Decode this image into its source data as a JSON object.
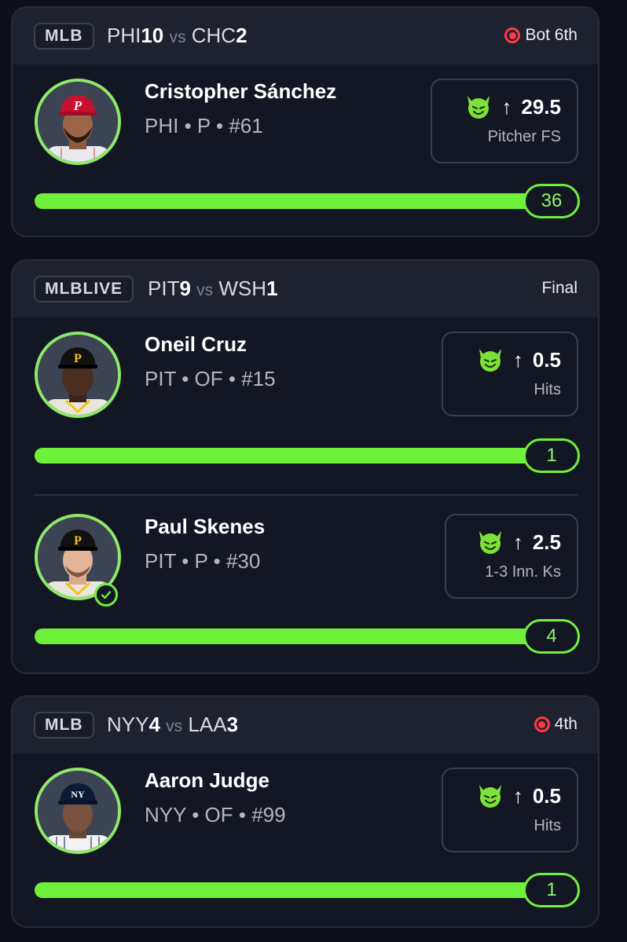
{
  "colors": {
    "accent": "#6ff03a",
    "live": "#ff3a48",
    "background": "#0d1018",
    "card": "#131723"
  },
  "games": [
    {
      "league": "MLB",
      "away_team": "PHI",
      "away_score": "10",
      "vs": "vs",
      "home_team": "CHC",
      "home_score": "2",
      "status": "Bot 6th",
      "live": true,
      "players": [
        {
          "name": "Cristopher Sánchez",
          "info": "PHI • P • #61",
          "icon": "devil-face-icon",
          "direction_icon": "arrow-up-icon",
          "line": "29.5",
          "stat": "Pitcher FS",
          "current": "36",
          "progress": 1.0,
          "cap": "phillies-cap"
        }
      ]
    },
    {
      "league": "MLBLIVE",
      "away_team": "PIT",
      "away_score": "9",
      "vs": "vs",
      "home_team": "WSH",
      "home_score": "1",
      "status": "Final",
      "live": false,
      "players": [
        {
          "name": "Oneil Cruz",
          "info": "PIT • OF • #15",
          "icon": "devil-face-icon",
          "direction_icon": "arrow-up-icon",
          "line": "0.5",
          "stat": "Hits",
          "current": "1",
          "progress": 1.0,
          "cap": "pirates-cap"
        },
        {
          "name": "Paul Skenes",
          "info": "PIT • P • #30",
          "icon": "devil-face-icon",
          "direction_icon": "arrow-up-icon",
          "line": "2.5",
          "stat": "1-3 Inn. Ks",
          "current": "4",
          "progress": 1.0,
          "cap": "pirates-cap",
          "checked": true
        }
      ]
    },
    {
      "league": "MLB",
      "away_team": "NYY",
      "away_score": "4",
      "vs": "vs",
      "home_team": "LAA",
      "home_score": "3",
      "status": "4th",
      "live": true,
      "players": [
        {
          "name": "Aaron Judge",
          "info": "NYY • OF • #99",
          "icon": "devil-face-icon",
          "direction_icon": "arrow-up-icon",
          "line": "0.5",
          "stat": "Hits",
          "current": "1",
          "progress": 1.0,
          "cap": "yankees-cap"
        }
      ]
    }
  ]
}
